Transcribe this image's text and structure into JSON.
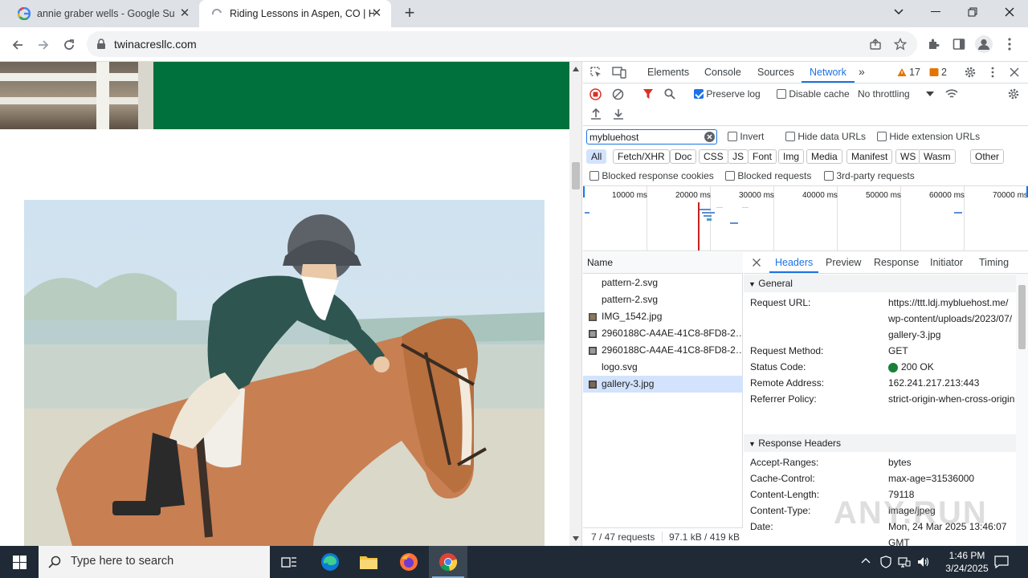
{
  "browser": {
    "tabs": [
      {
        "title": "annie graber wells - Google Such",
        "active": false
      },
      {
        "title": "Riding Lessons in Aspen, CO | H",
        "active": true
      }
    ],
    "url": "twinacresllc.com",
    "new_tab_symbol": "+",
    "close_symbol": "✕"
  },
  "devtools": {
    "tabs": [
      "Elements",
      "Console",
      "Sources",
      "Network"
    ],
    "active_tab": "Network",
    "warnings_count": "17",
    "errors_count": "2",
    "preserve_log_label": "Preserve log",
    "preserve_log_checked": true,
    "disable_cache_label": "Disable cache",
    "throttling_value": "No throttling",
    "filter_value": "mybluehost",
    "invert_label": "Invert",
    "hide_data_urls_label": "Hide data URLs",
    "hide_extension_urls_label": "Hide extension URLs",
    "type_filters": [
      "All",
      "Fetch/XHR",
      "Doc",
      "CSS",
      "JS",
      "Font",
      "Img",
      "Media",
      "Manifest",
      "WS",
      "Wasm",
      "Other"
    ],
    "active_type_filter": "All",
    "blocked_response_cookies_label": "Blocked response cookies",
    "blocked_requests_label": "Blocked requests",
    "third_party_label": "3rd-party requests",
    "timeline_labels": [
      "10000 ms",
      "20000 ms",
      "30000 ms",
      "40000 ms",
      "50000 ms",
      "60000 ms",
      "70000 ms"
    ],
    "name_column": "Name",
    "requests": [
      {
        "name": "pattern-2.svg",
        "icon": "none",
        "selected": false
      },
      {
        "name": "pattern-2.svg",
        "icon": "none",
        "selected": false
      },
      {
        "name": "IMG_1542.jpg",
        "icon": "image-icon",
        "selected": false
      },
      {
        "name": "2960188C-A4AE-41C8-8FD8-2…",
        "icon": "image-icon",
        "selected": false
      },
      {
        "name": "2960188C-A4AE-41C8-8FD8-2…",
        "icon": "image-icon",
        "selected": false
      },
      {
        "name": "logo.svg",
        "icon": "none",
        "selected": false
      },
      {
        "name": "gallery-3.jpg",
        "icon": "image-icon",
        "selected": true
      }
    ],
    "status": {
      "requests": "7 / 47 requests",
      "transferred": "97.1 kB / 419 kB"
    },
    "detail_tabs": [
      "Headers",
      "Preview",
      "Response",
      "Initiator",
      "Timing"
    ],
    "active_detail_tab": "Headers",
    "general_title": "General",
    "general": [
      {
        "key": "Request URL:",
        "value": "https://ttt.ldj.mybluehost.me/wp-content/uploads/2023/07/gallery-3.jpg"
      },
      {
        "key": "Request Method:",
        "value": "GET"
      },
      {
        "key": "Status Code:",
        "value": "200 OK"
      },
      {
        "key": "Remote Address:",
        "value": "162.241.217.213:443"
      },
      {
        "key": "Referrer Policy:",
        "value": "strict-origin-when-cross-origin"
      }
    ],
    "response_headers_title": "Response Headers",
    "response_headers": [
      {
        "key": "Accept-Ranges:",
        "value": "bytes"
      },
      {
        "key": "Cache-Control:",
        "value": "max-age=31536000"
      },
      {
        "key": "Content-Length:",
        "value": "79118"
      },
      {
        "key": "Content-Type:",
        "value": "image/jpeg"
      },
      {
        "key": "Date:",
        "value": "Mon, 24 Mar 2025 13:46:07 GMT"
      }
    ]
  },
  "taskbar": {
    "search_placeholder": "Type here to search",
    "time": "1:46 PM",
    "date": "3/24/2025"
  },
  "watermark": "ANY.RUN",
  "colors": {
    "page_green": "#00703c",
    "devtools_accent": "#1a73e8",
    "status_ok": "#188038",
    "taskbar": "#1f2a36"
  }
}
